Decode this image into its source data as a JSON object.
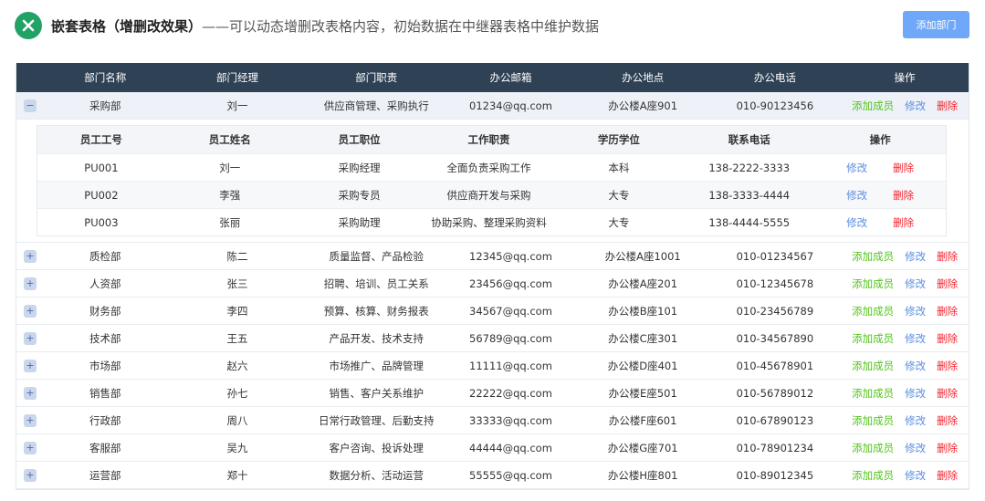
{
  "header": {
    "title_bold": "嵌套表格（增删改效果）",
    "title_rest": "——可以动态增删改表格内容，初始数据在中继器表格中维护数据",
    "add_button": "添加部门",
    "logo_icon": "excel-x-icon"
  },
  "table": {
    "columns": [
      "部门名称",
      "部门经理",
      "部门职责",
      "办公邮箱",
      "办公地点",
      "办公电话",
      "操作"
    ],
    "actions": {
      "add": "添加成员",
      "edit": "修改",
      "delete": "删除"
    },
    "toggle": {
      "expanded": "−",
      "collapsed": "+"
    },
    "rows": [
      {
        "name": "采购部",
        "manager": "刘一",
        "duty": "供应商管理、采购执行",
        "email": "01234@qq.com",
        "location": "办公楼A座901",
        "phone": "010-90123456",
        "expanded": true
      },
      {
        "name": "质检部",
        "manager": "陈二",
        "duty": "质量监督、产品检验",
        "email": "12345@qq.com",
        "location": "办公楼A座1001",
        "phone": "010-01234567"
      },
      {
        "name": "人资部",
        "manager": "张三",
        "duty": "招聘、培训、员工关系",
        "email": "23456@qq.com",
        "location": "办公楼A座201",
        "phone": "010-12345678"
      },
      {
        "name": "财务部",
        "manager": "李四",
        "duty": "预算、核算、财务报表",
        "email": "34567@qq.com",
        "location": "办公楼B座101",
        "phone": "010-23456789"
      },
      {
        "name": "技术部",
        "manager": "王五",
        "duty": "产品开发、技术支持",
        "email": "56789@qq.com",
        "location": "办公楼C座301",
        "phone": "010-34567890"
      },
      {
        "name": "市场部",
        "manager": "赵六",
        "duty": "市场推广、品牌管理",
        "email": "11111@qq.com",
        "location": "办公楼D座401",
        "phone": "010-45678901"
      },
      {
        "name": "销售部",
        "manager": "孙七",
        "duty": "销售、客户关系维护",
        "email": "22222@qq.com",
        "location": "办公楼E座501",
        "phone": "010-56789012"
      },
      {
        "name": "行政部",
        "manager": "周八",
        "duty": "日常行政管理、后勤支持",
        "email": "33333@qq.com",
        "location": "办公楼F座601",
        "phone": "010-67890123"
      },
      {
        "name": "客服部",
        "manager": "吴九",
        "duty": "客户咨询、投诉处理",
        "email": "44444@qq.com",
        "location": "办公楼G座701",
        "phone": "010-78901234"
      },
      {
        "name": "运营部",
        "manager": "郑十",
        "duty": "数据分析、活动运营",
        "email": "55555@qq.com",
        "location": "办公楼H座801",
        "phone": "010-89012345"
      }
    ]
  },
  "subtable": {
    "columns": [
      "员工工号",
      "员工姓名",
      "员工职位",
      "工作职责",
      "学历学位",
      "联系电话",
      "操作"
    ],
    "actions": {
      "edit": "修改",
      "delete": "删除"
    },
    "rows": [
      {
        "id": "PU001",
        "name": "刘一",
        "position": "采购经理",
        "duty": "全面负责采购工作",
        "degree": "本科",
        "phone": "138-2222-3333"
      },
      {
        "id": "PU002",
        "name": "李强",
        "position": "采购专员",
        "duty": "供应商开发与采购",
        "degree": "大专",
        "phone": "138-3333-4444"
      },
      {
        "id": "PU003",
        "name": "张丽",
        "position": "采购助理",
        "duty": "协助采购、整理采购资料",
        "degree": "大专",
        "phone": "138-4444-5555"
      }
    ]
  },
  "colors": {
    "header_bg": "#2f4154",
    "add": "#52c41a",
    "edit": "#5d8fe0",
    "delete": "#f5222d",
    "button": "#6fa8f8"
  }
}
